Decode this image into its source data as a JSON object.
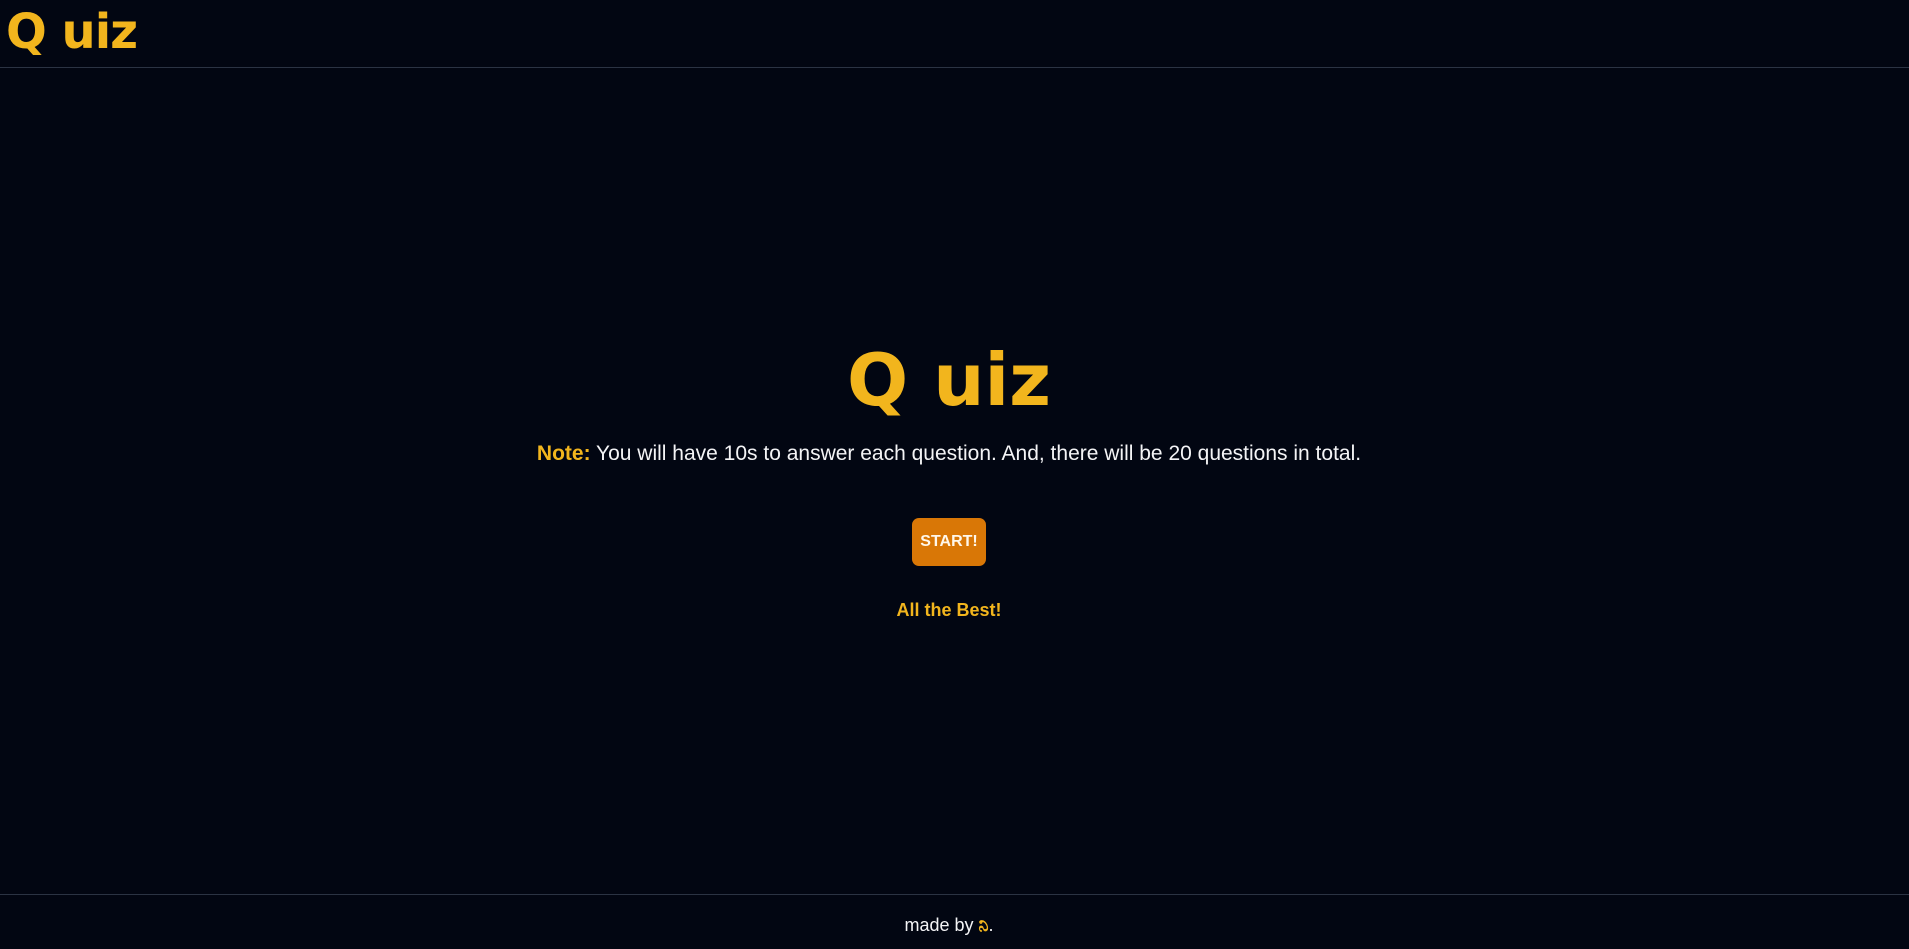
{
  "colors": {
    "background": "#020612",
    "accent": "#f2b51d",
    "button": "#d97706",
    "divider": "#2b3343",
    "text": "#f4f4f6"
  },
  "header": {
    "logo": "Q uiz"
  },
  "main": {
    "title": "Q uiz",
    "note_label": "Note:",
    "note_text": " You will have 10s to answer each question. And, there will be 20 questions in total.",
    "start_label": "START!",
    "closing": "All the Best!"
  },
  "footer": {
    "made_by": "made by ",
    "mark": "ನಿ",
    "suffix": "."
  }
}
